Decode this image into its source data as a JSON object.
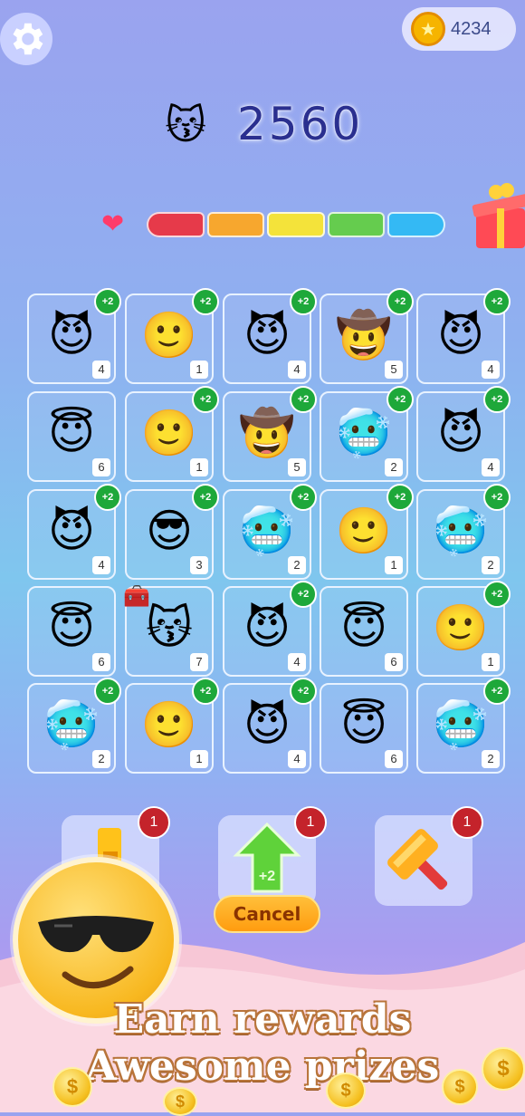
{
  "header": {
    "settings_icon": "gear-icon",
    "coins": "4234",
    "coin_icon": "star-coin-icon"
  },
  "score": {
    "emoji": "😽",
    "value": "2560"
  },
  "progress": {
    "heart_icon": "heart-icon",
    "segments": [
      "#e63a4a",
      "#f7a72e",
      "#f4e33a",
      "#65cc4e",
      "#34b9f4"
    ],
    "gift_icon": "gift-box-icon"
  },
  "grid": {
    "rows": [
      [
        {
          "emoji": "😈",
          "count": "4",
          "bonus": "+2"
        },
        {
          "emoji": "🙂",
          "count": "1",
          "bonus": "+2"
        },
        {
          "emoji": "😈",
          "count": "4",
          "bonus": "+2"
        },
        {
          "emoji": "🤠",
          "count": "5",
          "bonus": "+2"
        },
        {
          "emoji": "😈",
          "count": "4",
          "bonus": "+2"
        }
      ],
      [
        {
          "emoji": "😇",
          "count": "6",
          "bonus": ""
        },
        {
          "emoji": "🙂",
          "count": "1",
          "bonus": "+2"
        },
        {
          "emoji": "🤠",
          "count": "5",
          "bonus": "+2"
        },
        {
          "emoji": "🥶",
          "count": "2",
          "bonus": "+2"
        },
        {
          "emoji": "😈",
          "count": "4",
          "bonus": "+2"
        }
      ],
      [
        {
          "emoji": "😈",
          "count": "4",
          "bonus": "+2"
        },
        {
          "emoji": "😎",
          "count": "3",
          "bonus": "+2"
        },
        {
          "emoji": "🥶",
          "count": "2",
          "bonus": "+2"
        },
        {
          "emoji": "🙂",
          "count": "1",
          "bonus": "+2"
        },
        {
          "emoji": "🥶",
          "count": "2",
          "bonus": "+2"
        }
      ],
      [
        {
          "emoji": "😇",
          "count": "6",
          "bonus": ""
        },
        {
          "emoji": "😽",
          "count": "7",
          "bonus": "",
          "chest": "🧰"
        },
        {
          "emoji": "😈",
          "count": "4",
          "bonus": "+2"
        },
        {
          "emoji": "😇",
          "count": "6",
          "bonus": ""
        },
        {
          "emoji": "🙂",
          "count": "1",
          "bonus": "+2"
        }
      ],
      [
        {
          "emoji": "🥶",
          "count": "2",
          "bonus": "+2"
        },
        {
          "emoji": "🙂",
          "count": "1",
          "bonus": "+2"
        },
        {
          "emoji": "😈",
          "count": "4",
          "bonus": "+2"
        },
        {
          "emoji": "😇",
          "count": "6",
          "bonus": ""
        },
        {
          "emoji": "🥶",
          "count": "2",
          "bonus": "+2"
        }
      ]
    ]
  },
  "tools": {
    "swap": {
      "badge": "1",
      "icon": "swap-tool-icon"
    },
    "boost": {
      "badge": "1",
      "icon": "plus2-arrow-icon",
      "label": "+2"
    },
    "hammer": {
      "badge": "1",
      "icon": "hammer-icon"
    },
    "cancel_label": "Cancel"
  },
  "promo": {
    "line1": "Earn rewards",
    "line2": "Awesome prizes",
    "mascot_icon": "sunglasses-emoji-icon"
  }
}
